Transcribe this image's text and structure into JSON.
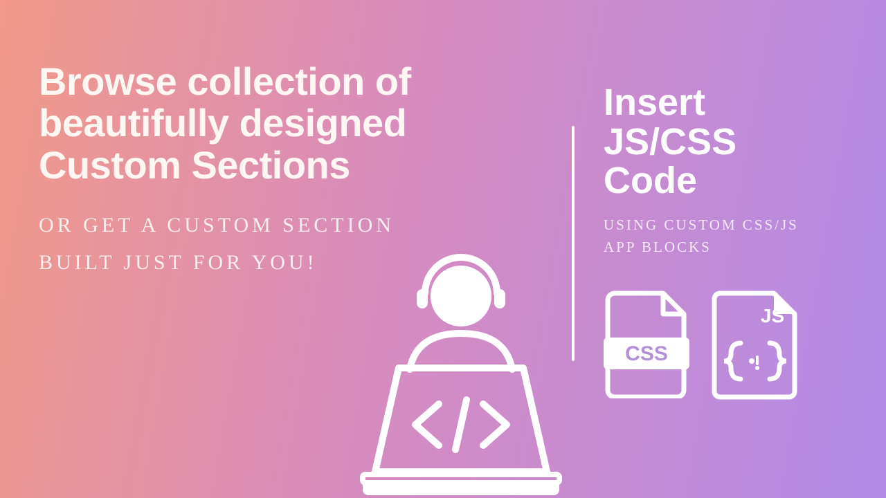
{
  "left": {
    "headline": "Browse collection of beautifully designed Custom Sections",
    "subhead": "OR GET A CUSTOM SECTION BUILT JUST FOR YOU!"
  },
  "right": {
    "title": "Insert JS/CSS Code",
    "sub": "USING CUSTOM CSS/JS APP BLOCKS"
  },
  "icons": {
    "css_label": "CSS",
    "js_label": "JS"
  }
}
